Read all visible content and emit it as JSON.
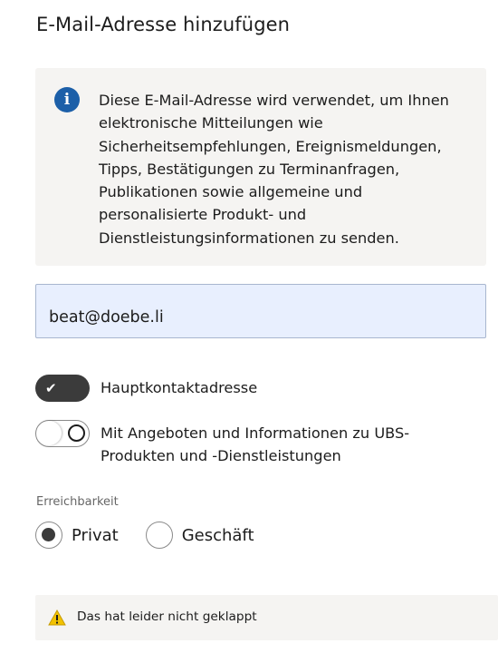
{
  "title": "E-Mail-Adresse hinzufügen",
  "info": {
    "icon": "info-icon",
    "text": "Diese E-Mail-Adresse wird verwendet, um Ihnen elektronische Mitteilungen wie Sicherheitsempfehlungen, Ereignismeldungen, Tipps, Bestätigungen zu Terminanfragen, Publikationen sowie allgemeine und personalisierte Produkt- und Dienstleistungsinformationen zu senden."
  },
  "email": {
    "value": "beat@doebe.li"
  },
  "toggles": [
    {
      "label": "Hauptkontaktadresse",
      "on": true
    },
    {
      "label": "Mit Angeboten und Informationen zu UBS-Produkten und -Dienstleistungen",
      "on": false
    }
  ],
  "reachability": {
    "label": "Erreichbarkeit",
    "options": [
      {
        "label": "Privat",
        "selected": true
      },
      {
        "label": "Geschäft",
        "selected": false
      }
    ]
  },
  "alert": {
    "icon": "warning-icon",
    "text": "Das hat leider nicht geklappt"
  },
  "colors": {
    "accent_blue": "#1c5fa8",
    "toggle_on": "#3b3b3b",
    "warning_yellow": "#f2c200",
    "field_bg": "#e8effe"
  }
}
